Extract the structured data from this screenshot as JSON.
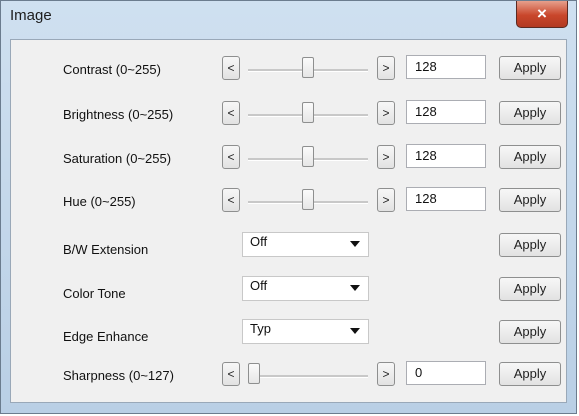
{
  "window": {
    "title": "Image",
    "close_label": "×"
  },
  "controls": {
    "arrow_left": "<",
    "arrow_right": ">",
    "apply_label": "Apply"
  },
  "sliders": [
    {
      "label": "Contrast (0~255)",
      "value": "128",
      "position_fraction": 0.5
    },
    {
      "label": "Brightness (0~255)",
      "value": "128",
      "position_fraction": 0.5
    },
    {
      "label": "Saturation (0~255)",
      "value": "128",
      "position_fraction": 0.5
    },
    {
      "label": "Hue (0~255)",
      "value": "128",
      "position_fraction": 0.5
    }
  ],
  "dropdowns": [
    {
      "label": "B/W Extension",
      "selected": "Off"
    },
    {
      "label": "Color Tone",
      "selected": "Off"
    },
    {
      "label": "Edge Enhance",
      "selected": "Typ"
    }
  ],
  "sharpness": {
    "label": "Sharpness (0~127)",
    "value": "0",
    "position_fraction": 0.0
  },
  "icons": {
    "close": "close-icon",
    "dropdown": "chevron-down-icon"
  },
  "colors": {
    "client_bg": "#f0f0f0",
    "title_bg": "#c7d9ec",
    "close_bg": "#c9462b"
  }
}
